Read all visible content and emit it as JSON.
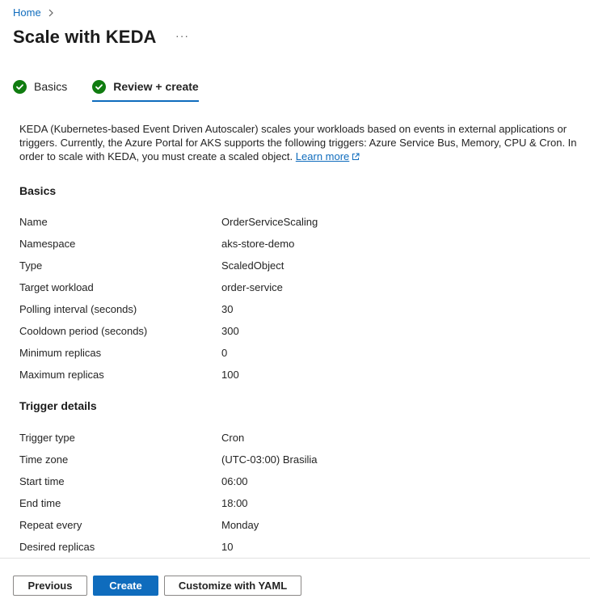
{
  "breadcrumb": {
    "home_label": "Home"
  },
  "header": {
    "title": "Scale with KEDA",
    "more_label": "···"
  },
  "tabs": [
    {
      "label": "Basics",
      "status": "complete"
    },
    {
      "label": "Review + create",
      "status": "complete",
      "selected": true
    }
  ],
  "description": {
    "text": "KEDA (Kubernetes-based Event Driven Autoscaler) scales your workloads based on events in external applications or triggers. Currently, the Azure Portal for AKS supports the following triggers: Azure Service Bus, Memory, CPU & Cron. In order to scale with KEDA, you must create a scaled object.",
    "link_label": "Learn more",
    "link_icon": "external-link-icon"
  },
  "basics": {
    "title": "Basics",
    "rows": [
      {
        "label": "Name",
        "value": "OrderServiceScaling"
      },
      {
        "label": "Namespace",
        "value": "aks-store-demo"
      },
      {
        "label": "Type",
        "value": "ScaledObject"
      },
      {
        "label": "Target workload",
        "value": "order-service"
      },
      {
        "label": "Polling interval (seconds)",
        "value": "30"
      },
      {
        "label": "Cooldown period (seconds)",
        "value": "300"
      },
      {
        "label": "Minimum replicas",
        "value": "0"
      },
      {
        "label": "Maximum replicas",
        "value": "100"
      }
    ]
  },
  "trigger": {
    "title": "Trigger details",
    "rows": [
      {
        "label": "Trigger type",
        "value": "Cron"
      },
      {
        "label": "Time zone",
        "value": "(UTC-03:00) Brasilia"
      },
      {
        "label": "Start time",
        "value": "06:00"
      },
      {
        "label": "End time",
        "value": "18:00"
      },
      {
        "label": "Repeat every",
        "value": "Monday"
      },
      {
        "label": "Desired replicas",
        "value": "10"
      }
    ]
  },
  "footer": {
    "previous_label": "Previous",
    "create_label": "Create",
    "yaml_label": "Customize with YAML"
  },
  "colors": {
    "accent": "#0f6cbd",
    "success": "#107c10",
    "text": "#242424"
  }
}
